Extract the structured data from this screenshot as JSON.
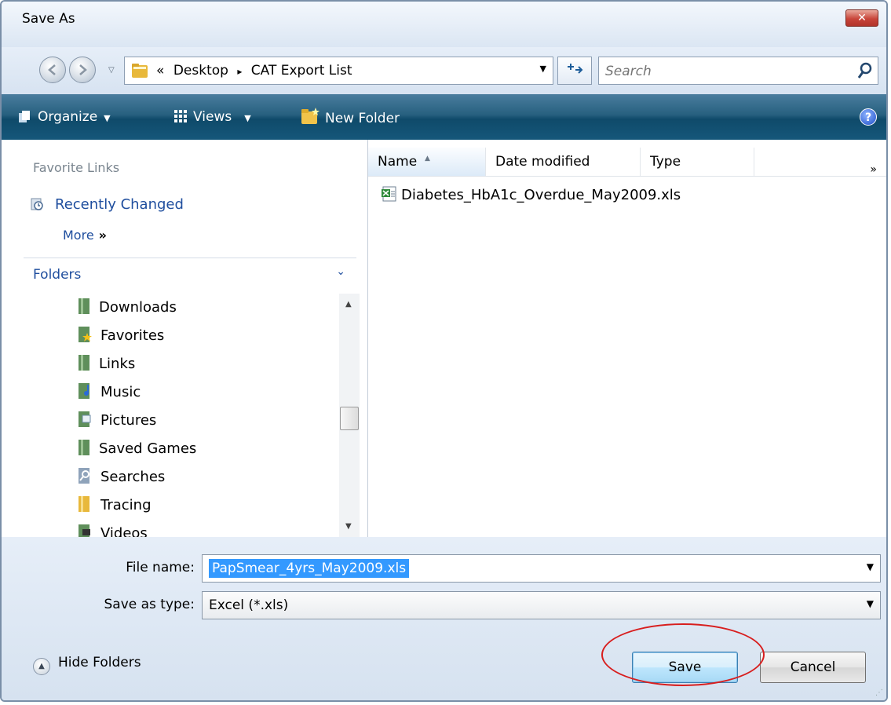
{
  "window": {
    "title": "Save As",
    "close_label": "✕"
  },
  "nav": {
    "breadcrumb_prefix": "«",
    "breadcrumb": [
      "Desktop",
      "CAT Export List"
    ],
    "breadcrumb_sep": "▸",
    "search_placeholder": "Search"
  },
  "toolbar": {
    "organize": "Organize",
    "views": "Views",
    "new_folder": "New Folder",
    "help": "?"
  },
  "sidebar": {
    "favorites_header": "Favorite Links",
    "favorites": [
      {
        "label": "Recently Changed",
        "icon": "recent-icon"
      }
    ],
    "more_label": "More",
    "more_chevron": "»",
    "folders_header": "Folders",
    "folders": [
      {
        "label": "Downloads",
        "icon": "folder-icon"
      },
      {
        "label": "Favorites",
        "icon": "favorites-icon"
      },
      {
        "label": "Links",
        "icon": "folder-icon"
      },
      {
        "label": "Music",
        "icon": "music-icon"
      },
      {
        "label": "Pictures",
        "icon": "pictures-icon"
      },
      {
        "label": "Saved Games",
        "icon": "folder-icon"
      },
      {
        "label": "Searches",
        "icon": "searches-icon"
      },
      {
        "label": "Tracing",
        "icon": "yellow-folder-icon"
      },
      {
        "label": "Videos",
        "icon": "videos-icon"
      }
    ]
  },
  "filelist": {
    "columns": [
      "Name",
      "Date modified",
      "Type"
    ],
    "more_columns": "»",
    "files": [
      {
        "name": "Diabetes_HbA1c_Overdue_May2009.xls",
        "icon": "excel-file-icon"
      }
    ]
  },
  "form": {
    "filename_label": "File name:",
    "filename_value": "PapSmear_4yrs_May2009.xls",
    "type_label": "Save as type:",
    "type_value": "Excel (*.xls)"
  },
  "footer": {
    "hide_folders": "Hide Folders",
    "save": "Save",
    "cancel": "Cancel"
  },
  "colors": {
    "toolbar": "#1b5a7c",
    "link": "#1f4e9e",
    "highlight": "#d81e1e",
    "selection": "#3399ff"
  }
}
